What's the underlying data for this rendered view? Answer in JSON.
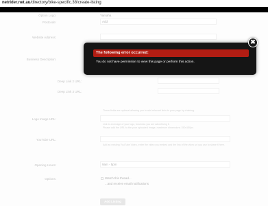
{
  "browser": {
    "url_domain": "netrider.net.au",
    "url_path": "/directory/bike-specific.38/create-listing"
  },
  "form": {
    "option_label": "Option Logo:",
    "option_value": "Yamaha",
    "postcode_label": "Postcode:",
    "postcode_value": "Add",
    "website_label": "Website Address:",
    "business_label": "Business Description:",
    "deep_link_2_label": "Deep Link 2 URL:",
    "deep_link_2_title": "Title",
    "deep_link_3_label": "Deep Link 3 URL:",
    "deep_link_3_title": "Title",
    "logo_help_top": "These fields are optional allowing you to add relevant links to your page by chaining.",
    "logo_label": "Logo Image URL:",
    "logo_help_1": "Link to an image of your logo, business you are advertising it.",
    "logo_help_2": "Please add the URL to the your uploaded image, maximum dimensions 150x150px.",
    "youtube_label": "YouTube URL:",
    "youtube_help": "Add an existing YouTube Video, enter the video you embed and the link of the video url you use to share it here.",
    "hours_label": "Opening Hours:",
    "hours_value": "9am - 5pm",
    "options_label": "Options:",
    "watch_label": "Watch this thread...",
    "email_label": "...and receive email notifications",
    "add_button": "Add Listing"
  },
  "error_dialog": {
    "title": "The following error occurred:",
    "message": "You do not have permission to view this page or perform this action.",
    "close_glyph": "✖"
  },
  "colors": {
    "error_red": "#b21d13",
    "dialog_bg": "#151515"
  }
}
